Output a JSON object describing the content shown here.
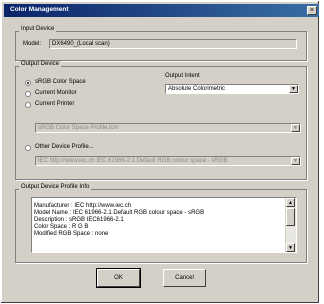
{
  "window": {
    "title": "Color Management",
    "close_glyph": "×"
  },
  "input_device": {
    "group_label": "Input Device",
    "model_label": "Model:",
    "model_value": "DX6490_(Local scan)"
  },
  "output_device": {
    "group_label": "Output Device",
    "options": [
      {
        "label": "sRGB Color Space",
        "checked": true
      },
      {
        "label": "Current Monitor",
        "checked": false
      },
      {
        "label": "Current Printer",
        "checked": false
      }
    ],
    "printer_select_value": "sRGB Color Space Profile.icm",
    "other_profile_label": "Other Device Profile...",
    "other_profile_value": "IEC http://www.iec.ch  IEC 61966-2.1 Default RGB colour space - sRGB",
    "output_intent_label": "Output Intent",
    "output_intent_value": "Absolute Colorimetric"
  },
  "profile_info": {
    "group_label": "Output Device Profile Info",
    "lines": [
      "Manufacturer : IEC http://www.iec.ch",
      "Model Name : IEC 61966-2.1 Default RGB colour space - sRGB",
      "Description : sRGB IEC61966-2.1",
      "Color Space : R G B",
      "Modified RGB Space : none"
    ]
  },
  "buttons": {
    "ok": "OK",
    "cancel": "Cancel"
  },
  "icons": {
    "dropdown": "▼",
    "scroll_up": "▲",
    "scroll_down": "▼"
  }
}
